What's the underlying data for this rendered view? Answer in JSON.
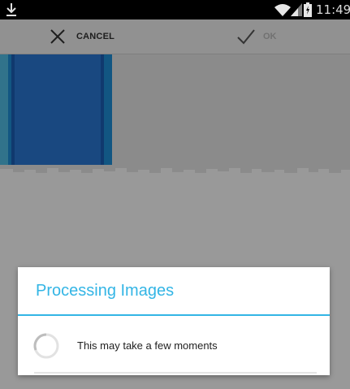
{
  "status_bar": {
    "time": "11:49",
    "icons": [
      "download-icon",
      "wifi-icon",
      "signal-icon",
      "battery-icon"
    ]
  },
  "action_bar": {
    "cancel_label": "CANCEL",
    "ok_label": "OK",
    "cancel_icon": "close-icon",
    "ok_icon": "check-icon"
  },
  "dialog": {
    "title": "Processing Images",
    "message": "This may take a few moments",
    "accent_color": "#33b5e5"
  }
}
